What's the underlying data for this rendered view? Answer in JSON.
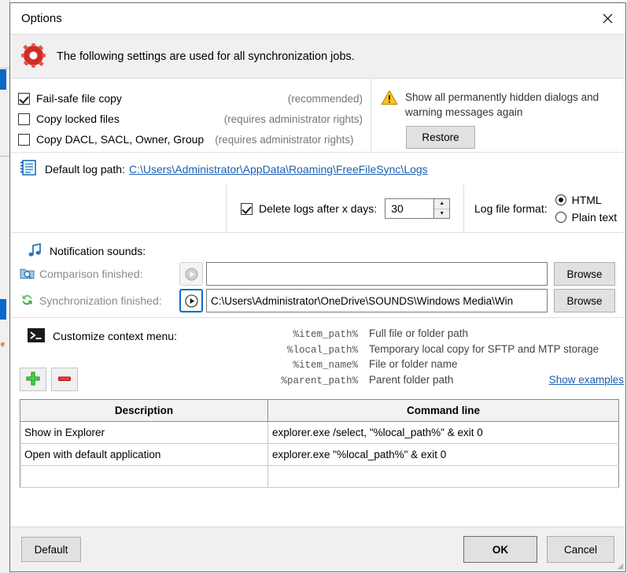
{
  "window": {
    "title": "Options",
    "close_icon": "close-icon",
    "header_text": "The following settings are used for all synchronization jobs.",
    "header_icon": "red-gear-icon"
  },
  "copy_options": {
    "items": [
      {
        "label": "Fail-safe file copy",
        "note": "(recommended)",
        "checked": true
      },
      {
        "label": "Copy locked files",
        "note": "(requires administrator rights)",
        "checked": false
      },
      {
        "label": "Copy DACL, SACL, Owner, Group",
        "note": "(requires administrator rights)",
        "checked": false
      }
    ]
  },
  "hidden_dialogs": {
    "icon": "warning-triangle-icon",
    "text": "Show all permanently hidden dialogs and warning messages again",
    "restore_label": "Restore"
  },
  "log": {
    "icon": "log-notebook-icon",
    "path_label": "Default log path:",
    "path_value": "C:\\Users\\Administrator\\AppData\\Roaming\\FreeFileSync\\Logs",
    "delete_logs_label": "Delete logs after x days:",
    "delete_logs_checked": true,
    "delete_logs_days": "30",
    "spin_up_icon": "spinner-up-icon",
    "spin_down_icon": "spinner-down-icon",
    "format_label": "Log file format:",
    "format_options": [
      {
        "label": "HTML",
        "selected": true
      },
      {
        "label": "Plain text",
        "selected": false
      }
    ]
  },
  "sounds": {
    "icon": "music-note-icon",
    "title": "Notification sounds:",
    "rows": [
      {
        "icon": "compare-magnifier-icon",
        "label": "Comparison finished:",
        "play_icon": "play-icon",
        "value": "",
        "focused": false,
        "browse_label": "Browse"
      },
      {
        "icon": "sync-arrows-icon",
        "label": "Synchronization finished:",
        "play_icon": "play-icon",
        "value": "C:\\Users\\Administrator\\OneDrive\\SOUNDS\\Windows Media\\Win",
        "focused": true,
        "browse_label": "Browse"
      }
    ]
  },
  "context_menu": {
    "icon": "console-prompt-icon",
    "title": "Customize context menu:",
    "add_icon": "plus-icon",
    "remove_icon": "minus-icon",
    "show_examples_label": "Show examples",
    "variables": [
      {
        "name": "%item_path%",
        "desc": "Full file or folder path"
      },
      {
        "name": "%local_path%",
        "desc": "Temporary local copy for SFTP and MTP storage"
      },
      {
        "name": "%item_name%",
        "desc": "File or folder name"
      },
      {
        "name": "%parent_path%",
        "desc": "Parent folder path"
      }
    ],
    "table": {
      "columns": [
        "Description",
        "Command line"
      ],
      "rows": [
        [
          "Show in Explorer",
          "explorer.exe /select, \"%local_path%\" & exit 0"
        ],
        [
          "Open with default application",
          "explorer.exe \"%local_path%\" & exit 0"
        ],
        [
          "",
          ""
        ]
      ]
    }
  },
  "footer": {
    "default_label": "Default",
    "ok_label": "OK",
    "cancel_label": "Cancel"
  },
  "colors": {
    "link": "#1a5fb4",
    "focus": "#0a6bcd",
    "header_band": "#f0f0f0",
    "accent_red": "#d9352c",
    "accent_green": "#3faa3f"
  }
}
